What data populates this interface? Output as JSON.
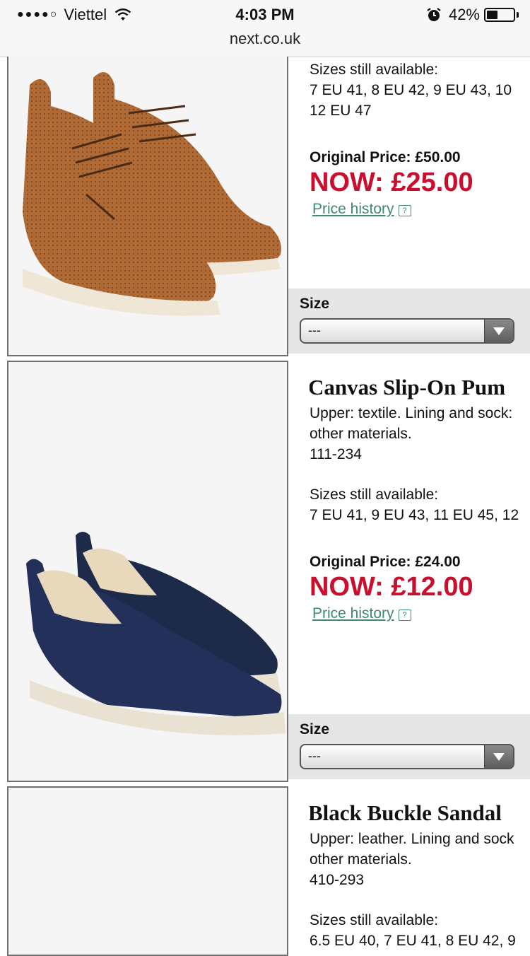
{
  "status_bar": {
    "carrier": "Viettel",
    "time": "4:03 PM",
    "battery_percent": "42%",
    "battery_level": 0.42,
    "url": "next.co.uk"
  },
  "products": [
    {
      "sizes_heading": "Sizes still available:",
      "sizes": "7 EU 41, 8 EU 42, 9 EU 43, 10",
      "sizes_more": "12 EU 47",
      "original_price": "Original Price: £50.00",
      "now_price": "NOW: £25.00",
      "price_history": "Price history",
      "size_label": "Size",
      "size_value": "---"
    },
    {
      "title": "Canvas Slip-On Pum",
      "description": "Upper: textile. Lining and sock:",
      "description_more": "other materials.",
      "code": "111-234",
      "sizes_heading": "Sizes still available:",
      "sizes": "7 EU 41, 9 EU 43, 11 EU 45, 12",
      "original_price": "Original Price: £24.00",
      "now_price": "NOW: £12.00",
      "price_history": "Price history",
      "size_label": "Size",
      "size_value": "---"
    },
    {
      "title": "Black Buckle Sandal",
      "description": "Upper: leather. Lining and sock",
      "description_more": "other materials.",
      "code": "410-293",
      "sizes_heading": "Sizes still available:",
      "sizes": "6.5 EU 40, 7 EU 41, 8 EU 42, 9"
    }
  ],
  "colors": {
    "now_price": "#c8102e",
    "link": "#3e8a72",
    "size_panel": "#e6e6e6"
  },
  "icons": [
    "signal-dots-icon",
    "wifi-icon",
    "alarm-icon",
    "battery-icon",
    "info-icon",
    "chevron-down-icon"
  ]
}
